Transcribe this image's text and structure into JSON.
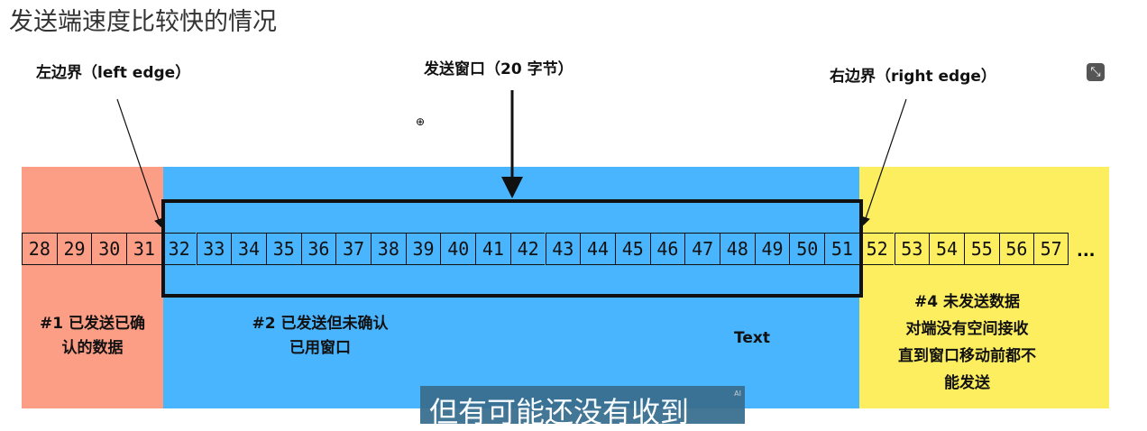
{
  "title": "发送端速度比较快的情况",
  "labels": {
    "left_edge": "左边界（left edge）",
    "window": "发送窗口（20 字节）",
    "right_edge": "右边界（right edge）"
  },
  "cells": [
    28,
    29,
    30,
    31,
    32,
    33,
    34,
    35,
    36,
    37,
    38,
    39,
    40,
    41,
    42,
    43,
    44,
    45,
    46,
    47,
    48,
    49,
    50,
    51,
    52,
    53,
    54,
    55,
    56,
    57
  ],
  "ellipsis": "...",
  "zones": {
    "z1": {
      "line1": "#1 已发送已确",
      "line2": "认的数据",
      "color": "#fc9d86"
    },
    "z2": {
      "line1": "#2 已发送但未确认",
      "line2": "已用窗口",
      "color": "#4ab5ff"
    },
    "z4": {
      "line1": "#4 未发送数据",
      "line2": "对端没有空间接收",
      "line3": "直到窗口移动前都不",
      "line4": "能发送",
      "color": "#fcee5e"
    }
  },
  "text_label": "Text",
  "subtitle": "但有可能还没有收到",
  "subtitle_badge": "AI",
  "icons": {
    "expand": "fullscreen-exit-icon",
    "cursor": "zoom-in-cursor-icon"
  }
}
